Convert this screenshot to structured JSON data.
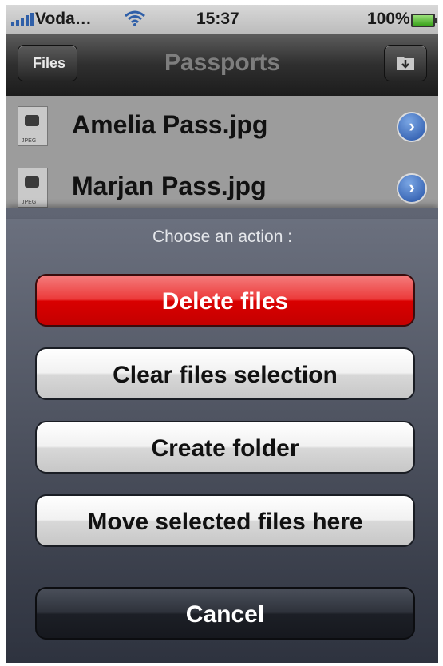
{
  "status_bar": {
    "carrier": "Voda…",
    "time": "15:37",
    "battery": "100%"
  },
  "nav_bar": {
    "back_label": "Files",
    "title": "Passports"
  },
  "files": [
    {
      "name": "Amelia Pass.jpg",
      "type": "JPEG"
    },
    {
      "name": "Marjan Pass.jpg",
      "type": "JPEG"
    }
  ],
  "action_sheet": {
    "title": "Choose an action :",
    "delete_label": "Delete files",
    "clear_label": "Clear files selection",
    "create_folder_label": "Create folder",
    "move_label": "Move selected files here",
    "cancel_label": "Cancel"
  },
  "colors": {
    "accent": "#2552a6",
    "danger": "#d90000"
  }
}
